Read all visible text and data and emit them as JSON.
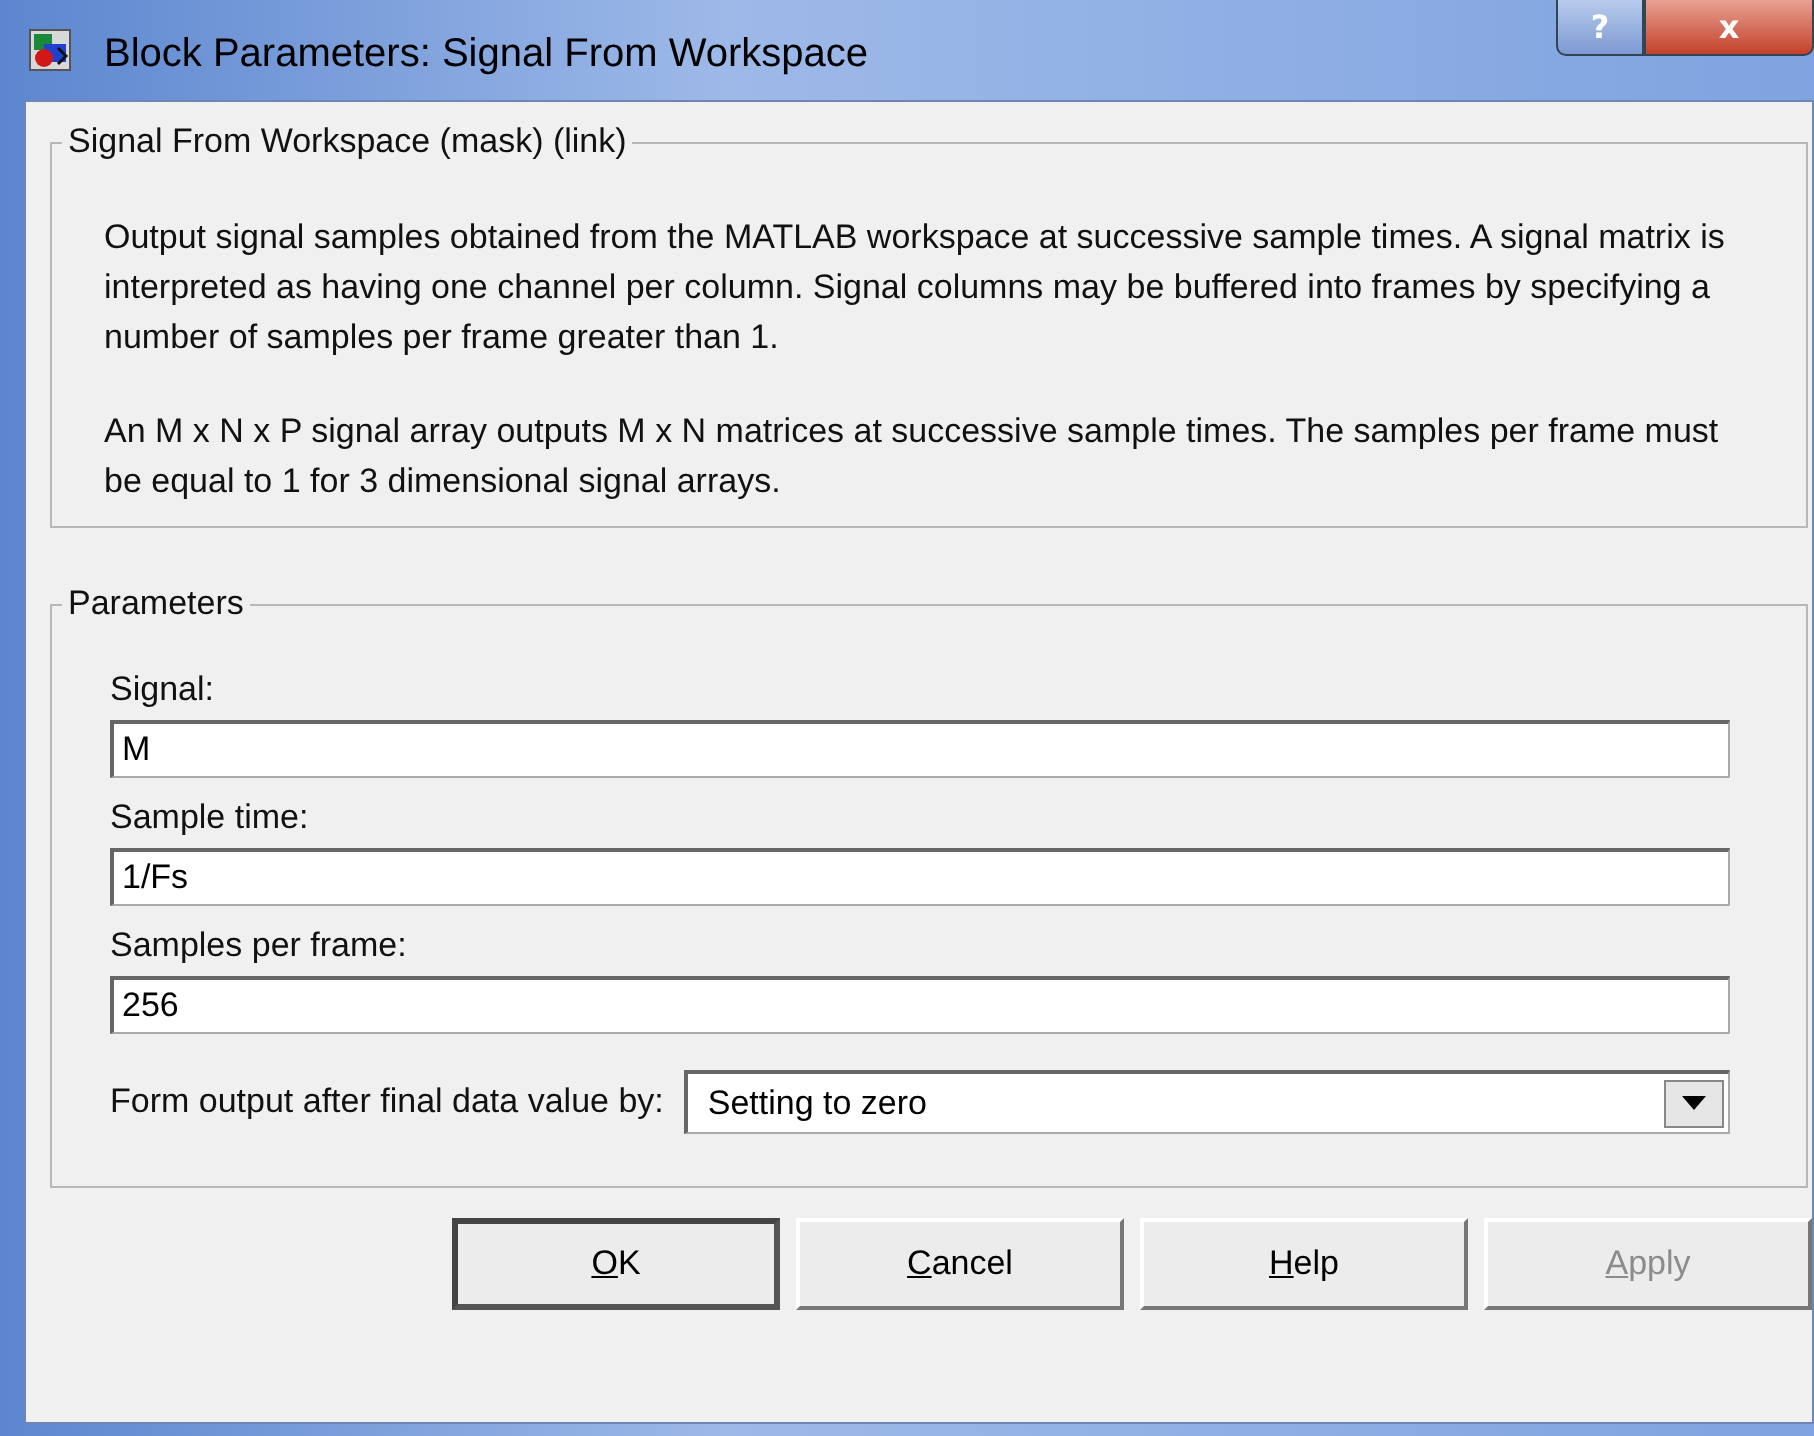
{
  "window": {
    "title": "Block Parameters: Signal From Workspace",
    "controls": [
      "?",
      "x"
    ]
  },
  "description_group": {
    "title": "Signal From Workspace (mask) (link)",
    "paragraphs": [
      "Output signal samples obtained from the MATLAB workspace at successive sample times.  A signal matrix is interpreted as having one channel per column.  Signal columns may be buffered into frames by specifying a number of samples per frame greater than 1.",
      "An M x N x P signal array outputs M x N matrices at successive sample times.  The samples per frame must be equal to 1 for 3 dimensional signal arrays."
    ]
  },
  "parameters": {
    "title": "Parameters",
    "fields": [
      {
        "kind": "text",
        "label": "Signal:",
        "value": "M"
      },
      {
        "kind": "text",
        "label": "Sample time:",
        "value": "1/Fs"
      },
      {
        "kind": "text",
        "label": "Samples per frame:",
        "value": "256"
      },
      {
        "kind": "dropdown",
        "label": "Form output after final data value by:",
        "value": "Setting to zero"
      }
    ]
  },
  "buttons": [
    {
      "label": "OK",
      "default": true,
      "disabled": false
    },
    {
      "label": "Cancel",
      "default": false,
      "disabled": false
    },
    {
      "label": "Help",
      "default": false,
      "disabled": false
    },
    {
      "label": "Apply",
      "default": false,
      "disabled": true
    }
  ]
}
